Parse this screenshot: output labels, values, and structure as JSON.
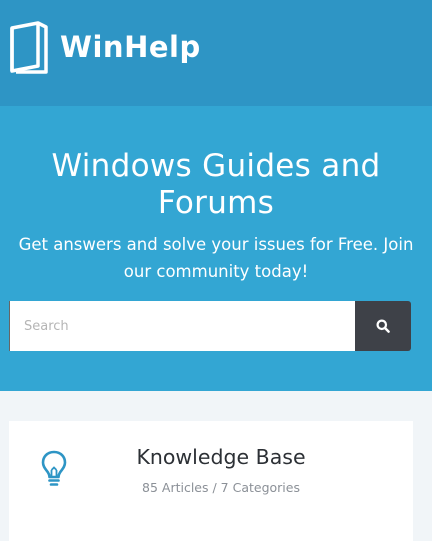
{
  "header": {
    "logo_text": "WinHelp",
    "logo_icon": "book-icon"
  },
  "hero": {
    "title_line1": "Windows Guides and",
    "title_line2": "Forums",
    "subtitle": "Get answers and solve your issues for Free. Join our community today!"
  },
  "search": {
    "placeholder": "Search",
    "value": "",
    "button_icon": "search-icon"
  },
  "cards": [
    {
      "icon": "lightbulb-icon",
      "title": "Knowledge Base",
      "meta": "85 Articles / 7 Categories"
    }
  ],
  "colors": {
    "header_bg": "#2e95c5",
    "hero_bg": "#33a6d3",
    "search_button_bg": "#3e4148",
    "icon_accent": "#2e95c5",
    "page_bg": "#f1f5f8"
  }
}
